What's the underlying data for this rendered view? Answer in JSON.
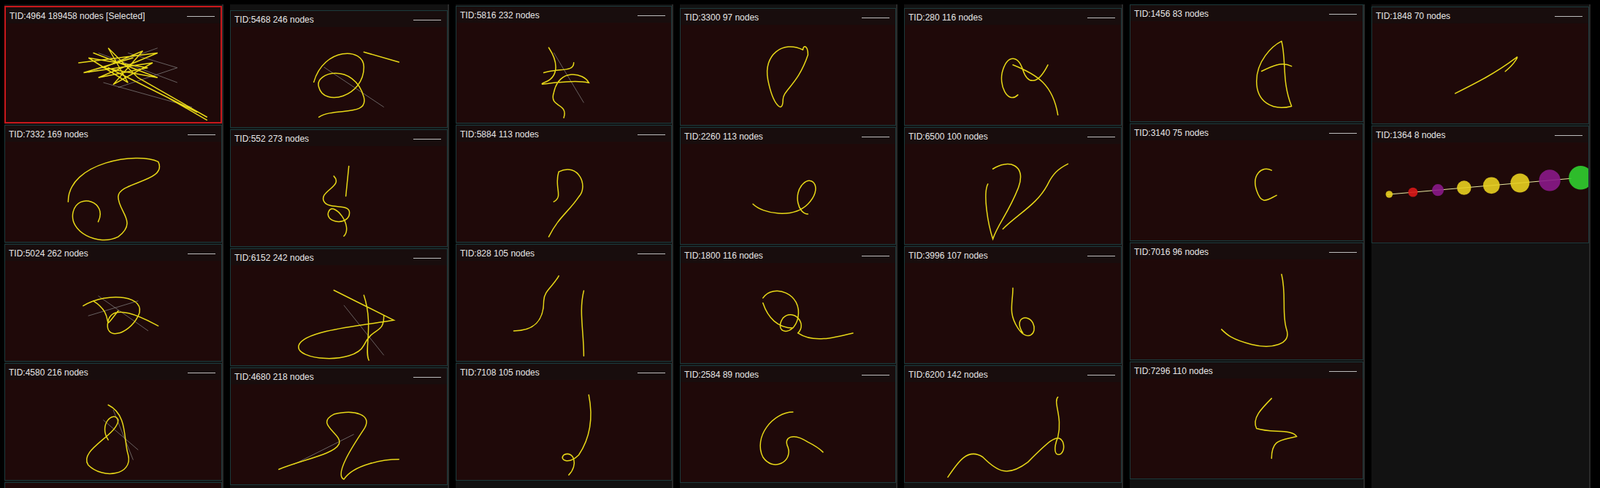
{
  "columns": [
    {
      "panels": [
        {
          "title": "TID:4964 189458 nodes [Selected]",
          "selected": true,
          "kind": "trace"
        },
        {
          "title": "TID:7332 169 nodes",
          "selected": false,
          "kind": "trace"
        },
        {
          "title": "TID:5024 262 nodes",
          "selected": false,
          "kind": "trace"
        },
        {
          "title": "TID:4580 216 nodes",
          "selected": false,
          "kind": "trace"
        }
      ]
    },
    {
      "panels": [
        {
          "title": "TID:5468 246 nodes",
          "selected": false,
          "kind": "trace"
        },
        {
          "title": "TID:552 273 nodes",
          "selected": false,
          "kind": "trace"
        },
        {
          "title": "TID:6152 242 nodes",
          "selected": false,
          "kind": "trace"
        },
        {
          "title": "TID:4680 218 nodes",
          "selected": false,
          "kind": "trace"
        }
      ]
    },
    {
      "panels": [
        {
          "title": "TID:5816 232 nodes",
          "selected": false,
          "kind": "trace"
        },
        {
          "title": "TID:5884 113 nodes",
          "selected": false,
          "kind": "trace"
        },
        {
          "title": "TID:828 105 nodes",
          "selected": false,
          "kind": "trace"
        },
        {
          "title": "TID:7108 105 nodes",
          "selected": false,
          "kind": "trace"
        }
      ]
    },
    {
      "panels": [
        {
          "title": "TID:3300 97 nodes",
          "selected": false,
          "kind": "trace"
        },
        {
          "title": "TID:2260 113 nodes",
          "selected": false,
          "kind": "trace"
        },
        {
          "title": "TID:1800 116 nodes",
          "selected": false,
          "kind": "trace"
        },
        {
          "title": "TID:2584 89 nodes",
          "selected": false,
          "kind": "trace"
        }
      ]
    },
    {
      "panels": [
        {
          "title": "TID:280 116 nodes",
          "selected": false,
          "kind": "trace"
        },
        {
          "title": "TID:6500 100 nodes",
          "selected": false,
          "kind": "trace"
        },
        {
          "title": "TID:3996 107 nodes",
          "selected": false,
          "kind": "trace"
        },
        {
          "title": "TID:6200 142 nodes",
          "selected": false,
          "kind": "trace"
        }
      ]
    },
    {
      "panels": [
        {
          "title": "TID:1456 83 nodes",
          "selected": false,
          "kind": "trace"
        },
        {
          "title": "TID:3140 75 nodes",
          "selected": false,
          "kind": "trace"
        },
        {
          "title": "TID:7016 96 nodes",
          "selected": false,
          "kind": "trace"
        },
        {
          "title": "TID:7296 110 nodes",
          "selected": false,
          "kind": "trace"
        }
      ]
    },
    {
      "panels": [
        {
          "title": "TID:1848 70 nodes",
          "selected": false,
          "kind": "trace"
        },
        {
          "title": "TID:1364 8 nodes",
          "selected": false,
          "kind": "markers",
          "markers": [
            {
              "color": "#e8d020"
            },
            {
              "color": "#d81818"
            },
            {
              "color": "#8a1a8a"
            },
            {
              "color": "#e8d020"
            },
            {
              "color": "#e8d020"
            },
            {
              "color": "#e8d020"
            },
            {
              "color": "#8a1a8a"
            },
            {
              "color": "#30d030"
            }
          ]
        }
      ]
    }
  ]
}
